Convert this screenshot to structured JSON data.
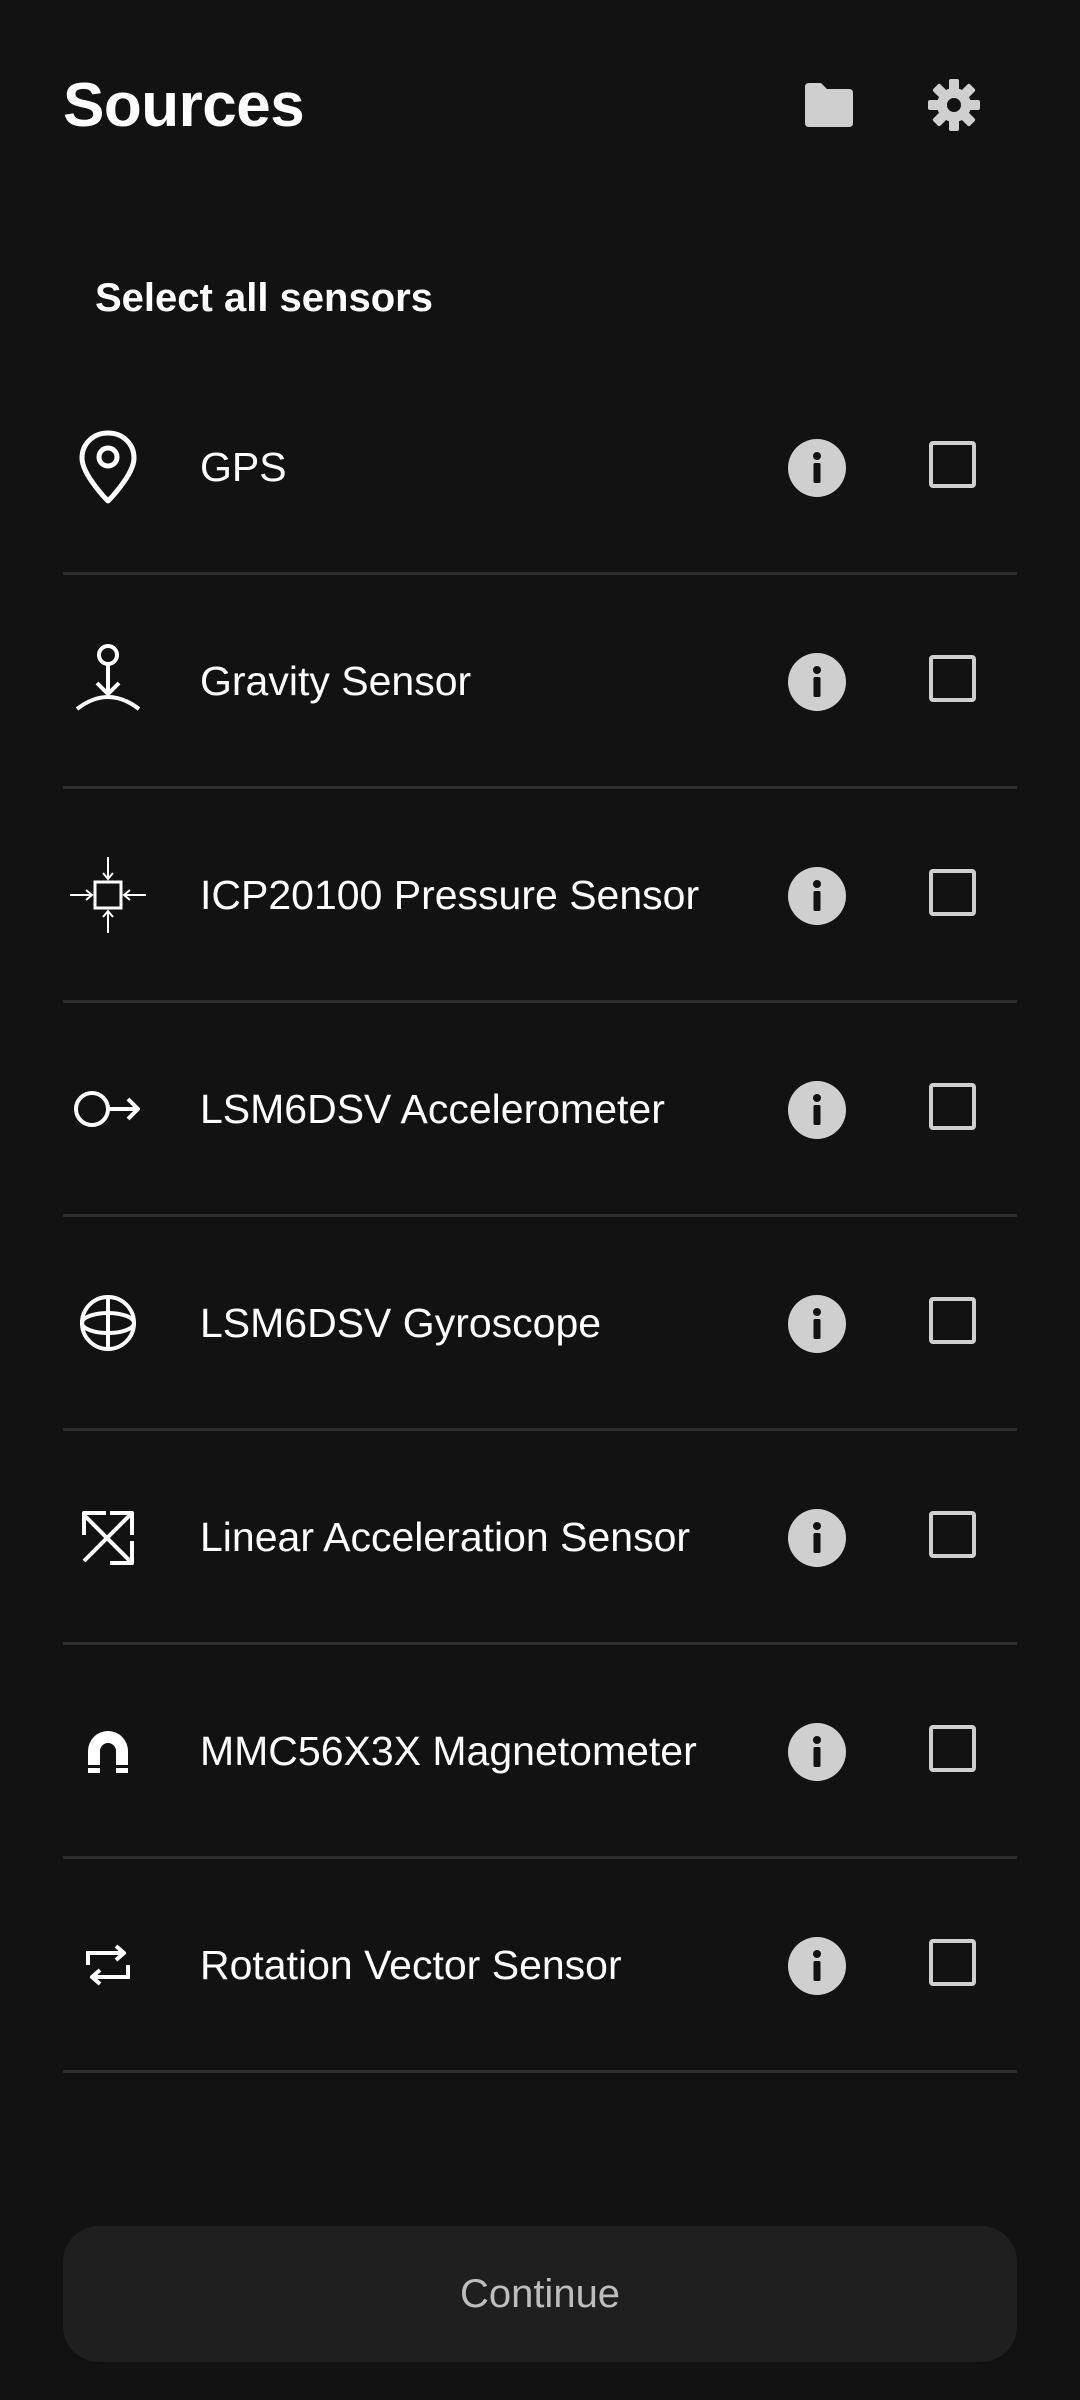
{
  "header": {
    "title": "Sources",
    "folder_icon": "folder-icon",
    "settings_icon": "gear-icon"
  },
  "select_all_label": "Select all sensors",
  "sensors": [
    {
      "label": "GPS",
      "icon": "location-pin-icon",
      "checked": false
    },
    {
      "label": "Gravity Sensor",
      "icon": "gravity-icon",
      "checked": false
    },
    {
      "label": "ICP20100 Pressure Sensor",
      "icon": "pressure-icon",
      "checked": false
    },
    {
      "label": "LSM6DSV Accelerometer",
      "icon": "accelerometer-icon",
      "checked": false
    },
    {
      "label": "LSM6DSV Gyroscope",
      "icon": "gyroscope-icon",
      "checked": false
    },
    {
      "label": "Linear Acceleration Sensor",
      "icon": "linear-acceleration-icon",
      "checked": false
    },
    {
      "label": "MMC56X3X Magnetometer",
      "icon": "magnet-icon",
      "checked": false
    },
    {
      "label": "Rotation Vector Sensor",
      "icon": "rotation-icon",
      "checked": false
    }
  ],
  "continue_label": "Continue",
  "colors": {
    "background": "#121212",
    "text": "#ffffff",
    "icon_grey": "#cfcfcf",
    "divider": "#2e2e2e",
    "button_bg": "#1f1f1f",
    "button_text": "#bdbdbd"
  }
}
